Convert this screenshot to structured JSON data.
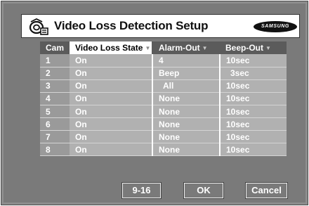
{
  "header": {
    "title": "Video Loss Detection Setup",
    "brand": "SAMSUNG"
  },
  "table": {
    "columns": [
      "Cam",
      "Video Loss State",
      "Alarm-Out",
      "Beep-Out"
    ],
    "rows": [
      {
        "cam": "1",
        "state": "On",
        "alarm": "4",
        "beep": "10sec"
      },
      {
        "cam": "2",
        "state": "On",
        "alarm": "Beep",
        "beep": "3sec"
      },
      {
        "cam": "3",
        "state": "On",
        "alarm": "All",
        "beep": "10sec"
      },
      {
        "cam": "4",
        "state": "On",
        "alarm": "None",
        "beep": "10sec"
      },
      {
        "cam": "5",
        "state": "On",
        "alarm": "None",
        "beep": "10sec"
      },
      {
        "cam": "6",
        "state": "On",
        "alarm": "None",
        "beep": "10sec"
      },
      {
        "cam": "7",
        "state": "On",
        "alarm": "None",
        "beep": "10sec"
      },
      {
        "cam": "8",
        "state": "On",
        "alarm": "None",
        "beep": "10sec"
      }
    ]
  },
  "buttons": {
    "next": "9-16",
    "ok": "OK",
    "cancel": "Cancel"
  },
  "colors": {
    "panel": "#7a7a7a",
    "header_row": "#5b5b5b",
    "cell": "#b1b1b1",
    "selected_header": "#ffffff"
  }
}
